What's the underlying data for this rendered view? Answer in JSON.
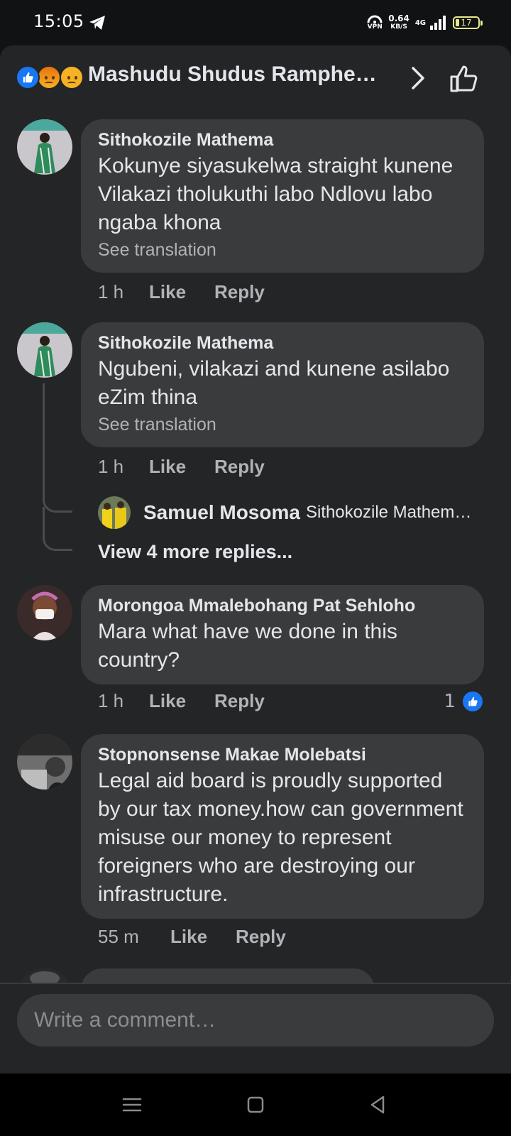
{
  "status": {
    "time": "15:05",
    "vpn": "VPN",
    "speed_value": "0.64",
    "speed_unit": "KB/S",
    "network": "4G",
    "battery": "17"
  },
  "header": {
    "title": "Mashudu Shudus Ramphe…",
    "reactions": [
      "like-icon",
      "angry-icon",
      "sad-icon"
    ]
  },
  "comments": [
    {
      "author": "Sithokozile Mathema",
      "text": "Kokunye siyasukelwa straight kunene Vilakazi tholukuthi labo Ndlovu labo ngaba khona",
      "see_translation": "See translation",
      "time": "1 h",
      "like": "Like",
      "reply": "Reply"
    },
    {
      "author": "Sithokozile Mathema",
      "text": "Ngubeni, vilakazi and kunene asilabo eZim thina",
      "see_translation": "See translation",
      "time": "1 h",
      "like": "Like",
      "reply": "Reply",
      "reply_preview": {
        "author": "Samuel Mosoma",
        "text": "Sithokozile Mathem…"
      },
      "view_more": "View 4 more replies..."
    },
    {
      "author": "Morongoa Mmalebohang Pat Sehloho",
      "text": "Mara what have we done in this country?",
      "time": "1 h",
      "like": "Like",
      "reply": "Reply",
      "like_count": "1"
    },
    {
      "author": "Stopnonsense Makae Molebatsi",
      "text": "Legal aid board is proudly supported by our tax money.how can government misuse our money to represent foreigners who are destroying our infrastructure.",
      "time": "55 m",
      "like": "Like",
      "reply": "Reply"
    }
  ],
  "composer": {
    "placeholder": "Write a comment…"
  },
  "colors": {
    "background": "#242527",
    "bubble": "#3a3b3c",
    "accent": "#1877f2",
    "secondary_text": "#b0b3b8"
  }
}
